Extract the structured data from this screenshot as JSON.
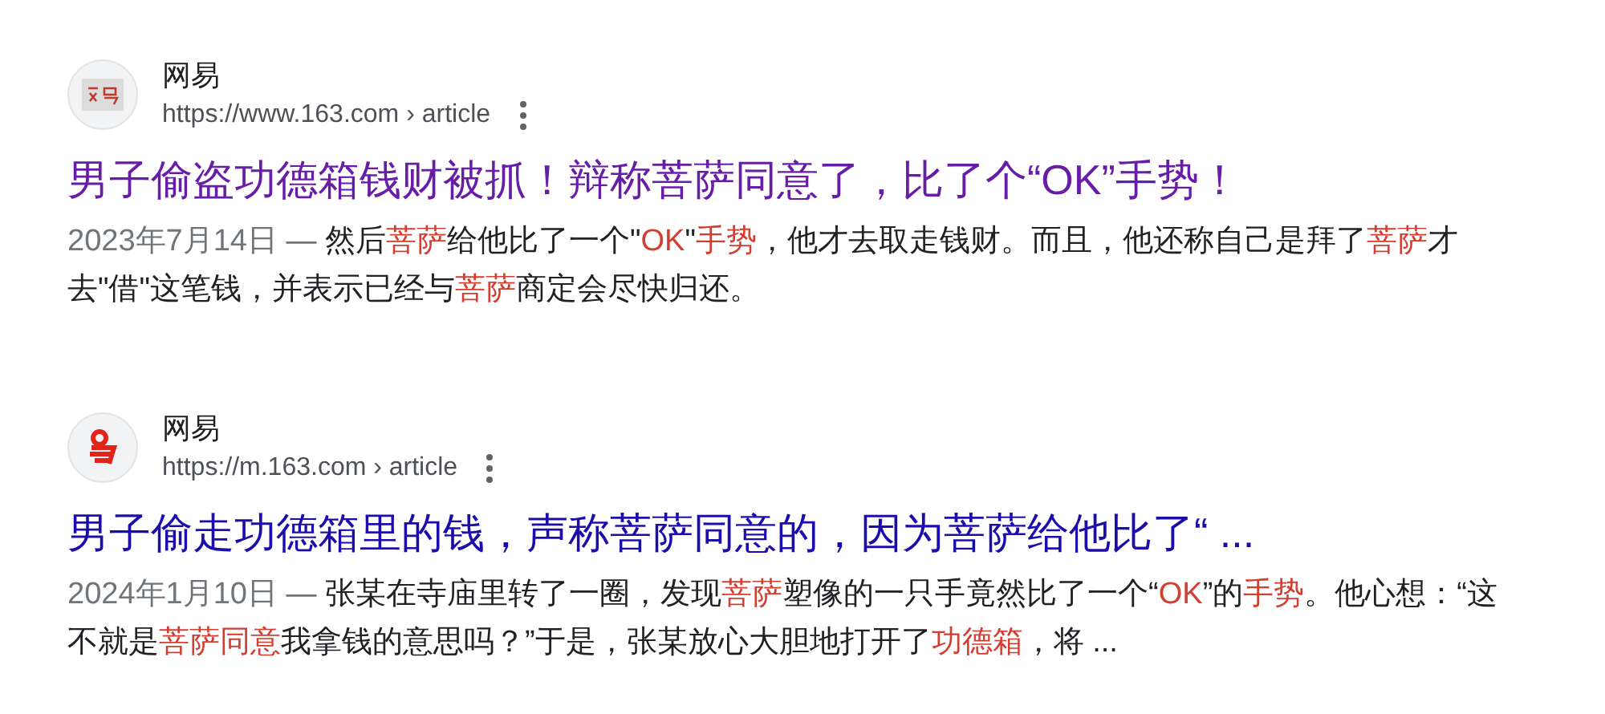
{
  "results": [
    {
      "source": "网易",
      "url": "https://www.163.com › article",
      "favicon": {
        "kind": "square"
      },
      "visited": true,
      "title": "男子偷盗功德箱钱财被抓！辩称菩萨同意了，比了个“OK”手势！",
      "date": "2023年7月14日 — ",
      "snippet": [
        {
          "text": "然后",
          "highlight": false
        },
        {
          "text": "菩萨",
          "highlight": true
        },
        {
          "text": "给他比了一个\"",
          "highlight": false
        },
        {
          "text": "OK",
          "highlight": true
        },
        {
          "text": "\"",
          "highlight": false
        },
        {
          "text": "手势",
          "highlight": true
        },
        {
          "text": "，他才去取走钱财。而且，他还称自己是拜了",
          "highlight": false
        },
        {
          "text": "菩萨",
          "highlight": true
        },
        {
          "text": "才去\"借\"这笔钱，并表示已经与",
          "highlight": false
        },
        {
          "text": "菩萨",
          "highlight": true
        },
        {
          "text": "商定会尽快归还。",
          "highlight": false
        }
      ]
    },
    {
      "source": "网易",
      "url": "https://m.163.com › article",
      "favicon": {
        "kind": "seal"
      },
      "visited": false,
      "title": "男子偷走功德箱里的钱，声称菩萨同意的，因为菩萨给他比了“ ...",
      "date": "2024年1月10日 — ",
      "snippet": [
        {
          "text": "张某在寺庙里转了一圈，发现",
          "highlight": false
        },
        {
          "text": "菩萨",
          "highlight": true
        },
        {
          "text": "塑像的一只手竟然比了一个“",
          "highlight": false
        },
        {
          "text": "OK",
          "highlight": true
        },
        {
          "text": "”的",
          "highlight": false
        },
        {
          "text": "手势",
          "highlight": true
        },
        {
          "text": "。他心想：“这不就是",
          "highlight": false
        },
        {
          "text": "菩萨同意",
          "highlight": true
        },
        {
          "text": "我拿钱的意思吗？”于是，张某放心大胆地打开了",
          "highlight": false
        },
        {
          "text": "功德箱",
          "highlight": true
        },
        {
          "text": "，将 ...",
          "highlight": false
        }
      ]
    }
  ]
}
